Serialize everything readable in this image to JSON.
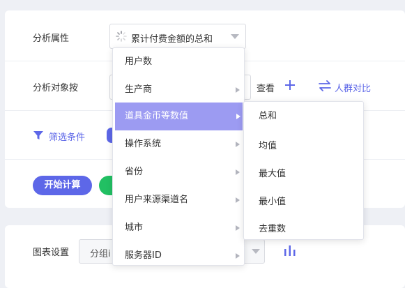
{
  "filters": {
    "analysis_attr_label": "分析属性",
    "analysis_attr_value": "累计付费金额的总和",
    "analysis_target_label": "分析对象按",
    "view_label": "查看",
    "crowd_compare_label": "人群对比",
    "filter_conditions_label": "筛选条件",
    "start_calc_label": "开始计算"
  },
  "chart_settings": {
    "label": "图表设置",
    "group_select_value": "分组i"
  },
  "menu": {
    "items": [
      {
        "label": "用户数",
        "submenu": false
      },
      {
        "label": "生产商",
        "submenu": true
      },
      {
        "label": "道具金币等数值",
        "submenu": true,
        "active": true
      },
      {
        "label": "操作系统",
        "submenu": true
      },
      {
        "label": "省份",
        "submenu": true
      },
      {
        "label": "用户来源渠道名",
        "submenu": true
      },
      {
        "label": "城市",
        "submenu": true
      },
      {
        "label": "服务器ID",
        "submenu": true
      }
    ]
  },
  "submenu": {
    "items": [
      "总和",
      "均值",
      "最大值",
      "最小值",
      "去重数"
    ]
  },
  "colors": {
    "accent": "#5d67e8",
    "active_item": "#9c9bf2",
    "green": "#22c063"
  }
}
